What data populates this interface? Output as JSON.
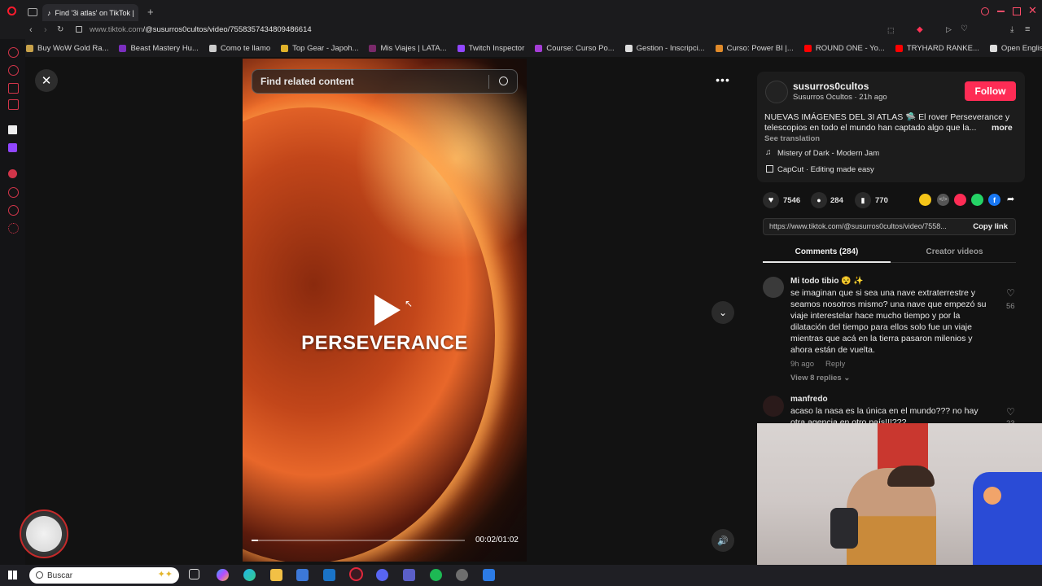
{
  "browser": {
    "tab_title": "Find '3i atlas' on TikTok |",
    "url_host": "www.tiktok.com",
    "url_path": "/@susurros0cultos/video/7558357434809486614",
    "bookmarks": [
      {
        "label": "Buy WoW Gold Ra...",
        "color": "#c8a24a"
      },
      {
        "label": "Beast Mastery Hu...",
        "color": "#7b2fbf"
      },
      {
        "label": "Como te llamo",
        "color": "#cccccc"
      },
      {
        "label": "Top Gear - Japoh...",
        "color": "#e0b22a"
      },
      {
        "label": "Mis Viajes | LATA...",
        "color": "#7a2a6a"
      },
      {
        "label": "Twitch Inspector",
        "color": "#9146ff"
      },
      {
        "label": "Course: Curso Po...",
        "color": "#a53dd6"
      },
      {
        "label": "Gestion - Inscripci...",
        "color": "#dddddd"
      },
      {
        "label": "Curso: Power BI |...",
        "color": "#e08a2a"
      },
      {
        "label": "ROUND ONE - Yo...",
        "color": "#ff0000"
      },
      {
        "label": "TRYHARD RANKE...",
        "color": "#ff0000"
      },
      {
        "label": "Open English Plat...",
        "color": "#dddddd"
      }
    ]
  },
  "player": {
    "search_placeholder": "Find related content",
    "overlay_text": "PERSEVERANCE",
    "time": "00:02/01:02",
    "progress": 0.032
  },
  "post": {
    "username": "susurros0cultos",
    "display_meta": "Susurros Ocultos · 21h ago",
    "follow_label": "Follow",
    "caption_line1": "NUEVAS IMÁGENES DEL 3I ATLAS 🛸 El rover Perseverance y",
    "caption_line2": "telescopios en todo el mundo han captado algo que la...",
    "more_label": "more",
    "see_translation": "See translation",
    "music": "Mistery of Dark - Modern Jam",
    "capcut": "CapCut · Editing made easy",
    "likes": "7546",
    "comments": "284",
    "saves": "770",
    "share_colors": [
      "#f5c518",
      "#555555",
      "#fe2c55",
      "#25d366",
      "#1877f2"
    ],
    "link_url": "https://www.tiktok.com/@susurros0cultos/video/7558...",
    "copy_link_label": "Copy link"
  },
  "tabs": {
    "comments_label": "Comments (284)",
    "creator_label": "Creator videos"
  },
  "comments": [
    {
      "name": "Mi todo tibio 😵 ✨",
      "lines": [
        "se imaginan que si sea una nave extraterrestre y",
        "seamos nosotros mismo? una nave que empezó su",
        "viaje interestelar hace mucho tiempo y por la",
        "dilatación del tiempo para ellos solo fue un viaje",
        "mientras que acá en la tierra pasaron milenios y",
        "ahora están de vuelta."
      ],
      "time": "9h ago",
      "reply_label": "Reply",
      "likes": "56",
      "view_replies": "View 8 replies"
    },
    {
      "name": "manfredo",
      "lines": [
        "acaso la nasa es la única en el mundo??? no hay",
        "otra agencia en otro país!!!???"
      ],
      "likes": "23"
    }
  ],
  "taskbar": {
    "search_label": "Buscar"
  }
}
